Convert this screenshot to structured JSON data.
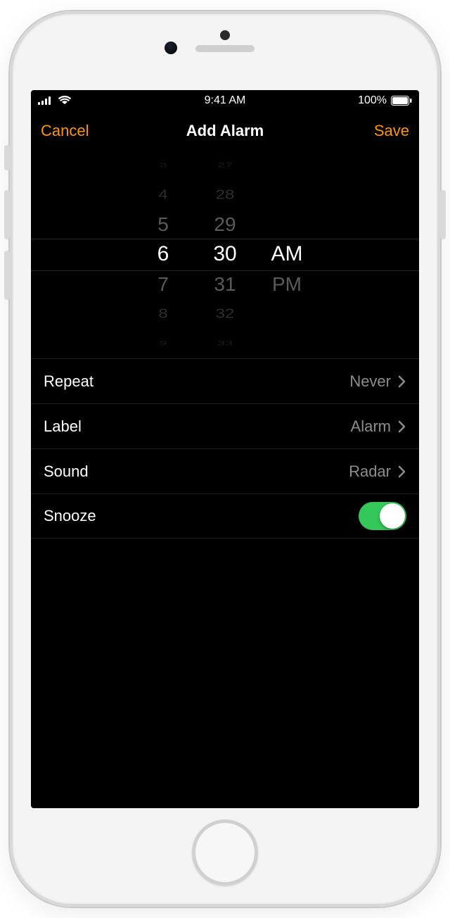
{
  "status": {
    "time": "9:41 AM",
    "battery": "100%"
  },
  "nav": {
    "cancel": "Cancel",
    "title": "Add Alarm",
    "save": "Save"
  },
  "picker": {
    "hours": [
      "3",
      "4",
      "5",
      "6",
      "7",
      "8",
      "9"
    ],
    "minutes": [
      "27",
      "28",
      "29",
      "30",
      "31",
      "32",
      "33"
    ],
    "period": [
      "AM",
      "PM"
    ],
    "selected_hour": "6",
    "selected_minute": "30",
    "selected_period": "AM"
  },
  "rows": {
    "repeat": {
      "label": "Repeat",
      "value": "Never"
    },
    "label": {
      "label": "Label",
      "value": "Alarm"
    },
    "sound": {
      "label": "Sound",
      "value": "Radar"
    },
    "snooze": {
      "label": "Snooze",
      "on": true
    }
  }
}
